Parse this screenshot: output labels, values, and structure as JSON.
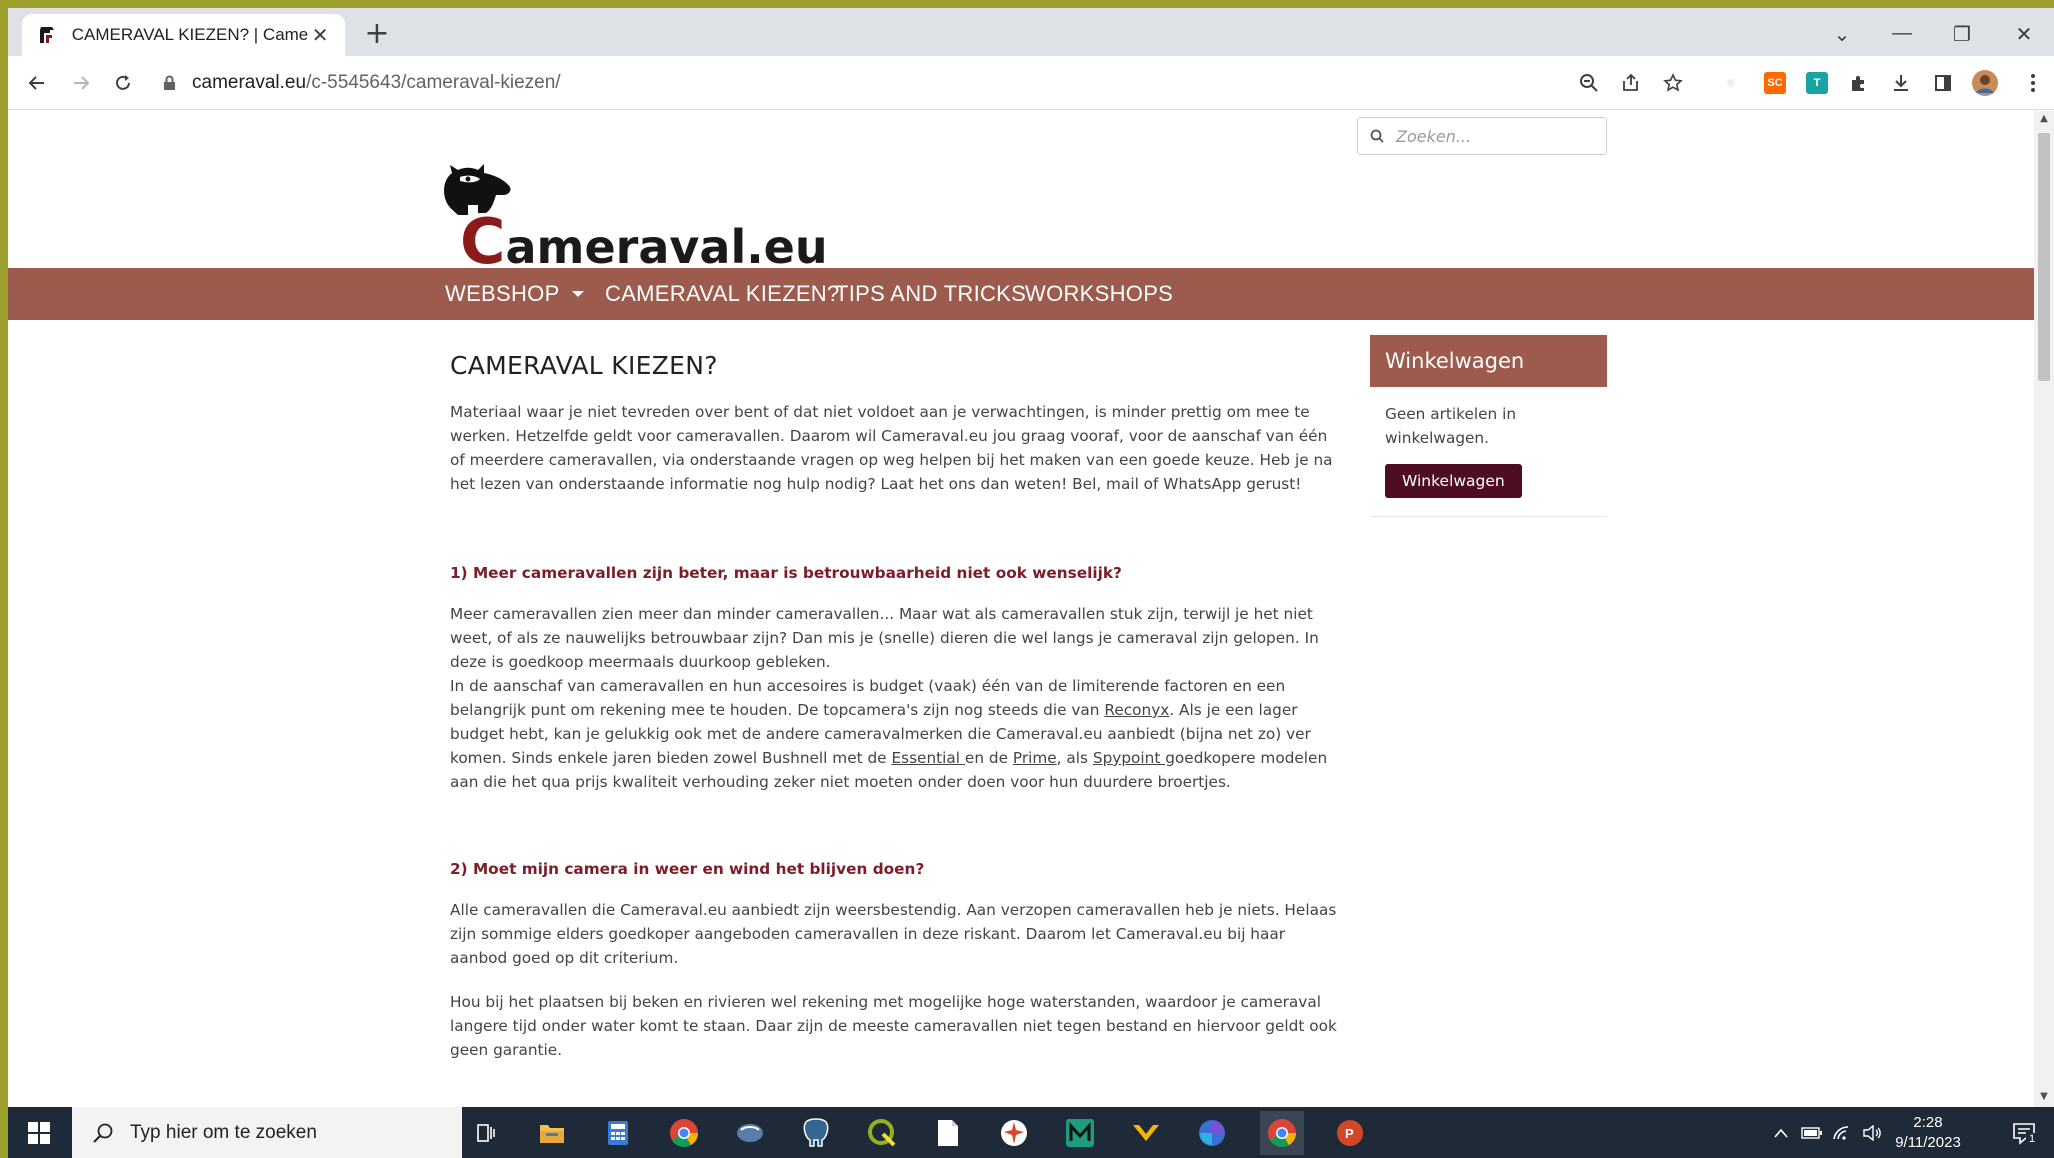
{
  "browser": {
    "tab_title": "CAMERAVAL KIEZEN? | Cameraval.eu",
    "new_tab_label": "+",
    "url_host": "cameraval.eu",
    "url_path": "/c-5545643/cameraval-kiezen/",
    "extensions": [
      {
        "name": "sc-extension",
        "label": "SC",
        "color": "#ff6a00"
      },
      {
        "name": "teal-extension",
        "label": "T",
        "color": "#1aa3a3"
      }
    ]
  },
  "site": {
    "search_placeholder": "Zoeken...",
    "logo_c": "C",
    "logo_text": "ameraval.eu",
    "nav": [
      {
        "label": "WEBSHOP"
      },
      {
        "label": "CAMERAVAL KIEZEN?"
      },
      {
        "label": "TIPS AND TRICKS"
      },
      {
        "label": "WORKSHOPS"
      }
    ],
    "page_title": "CAMERAVAL KIEZEN?",
    "intro": "Materiaal waar je niet tevreden over bent of dat niet voldoet aan je verwachtingen, is minder prettig om mee te werken. Hetzelfde geldt voor cameravallen. Daarom wil Cameraval.eu jou graag vooraf, voor de aanschaf van één of meerdere cameravallen, via onderstaande vragen op weg helpen bij het maken van een goede keuze. Heb je na het lezen van onderstaande informatie nog hulp nodig? Laat het ons dan weten! Bel, mail of WhatsApp gerust!",
    "q1": {
      "heading": "1) Meer cameravallen zijn beter, maar is betrouwbaarheid niet ook wenselijk?",
      "p1": "Meer cameravallen zien meer dan minder cameravallen... Maar wat als cameravallen stuk zijn, terwijl je het niet weet, of als ze nauwelijks betrouwbaar zijn? Dan mis je (snelle) dieren die wel langs je cameraval zijn gelopen. In deze is goedkoop meermaals duurkoop gebleken.",
      "p2_a": "In de aanschaf van cameravallen en hun accesoires is budget (vaak) één van de limiterende factoren en een belangrijk punt om rekening mee te houden. De topcamera's zijn nog steeds die van ",
      "link_reconyx": "Reconyx",
      "p2_b": ". Als je een lager budget hebt, kan je gelukkig ook met de andere cameravalmerken die Cameraval.eu aanbiedt (bijna net zo) ver komen. Sinds enkele jaren bieden zowel Bushnell met de ",
      "link_essential": "Essential ",
      "p2_c": "en de ",
      "link_prime": "Prime",
      "p2_d": ", als ",
      "link_spypoint": "Spypoint ",
      "p2_e": " goedkopere modelen aan die het qua prijs kwaliteit verhouding zeker niet moeten onder doen voor hun duurdere broertjes."
    },
    "q2": {
      "heading": "2) Moet mijn camera in weer en wind het blijven doen?",
      "p1": "Alle cameravallen die Cameraval.eu aanbiedt zijn weersbestendig. Aan verzopen cameravallen heb je niets. Helaas zijn sommige elders goedkoper aangeboden cameravallen in deze riskant. Daarom let Cameraval.eu bij haar aanbod goed op dit criterium.",
      "p2": "Hou bij het plaatsen bij beken en rivieren wel rekening met mogelijke hoge waterstanden, waardoor je cameraval langere tijd onder water komt te staan. Daar zijn de meeste cameravallen niet tegen bestand en hiervoor geldt ook geen garantie."
    },
    "cart": {
      "title": "Winkelwagen",
      "empty_text": "Geen artikelen in winkelwagen.",
      "button": "Winkelwagen"
    }
  },
  "taskbar": {
    "search_placeholder": "Typ hier om te zoeken",
    "time": "2:28",
    "date": "9/11/2023",
    "notification_count": "1"
  },
  "colors": {
    "nav_bg": "#9c5b4d",
    "heading": "#7c1d27",
    "cart_button": "#4e0d22"
  }
}
